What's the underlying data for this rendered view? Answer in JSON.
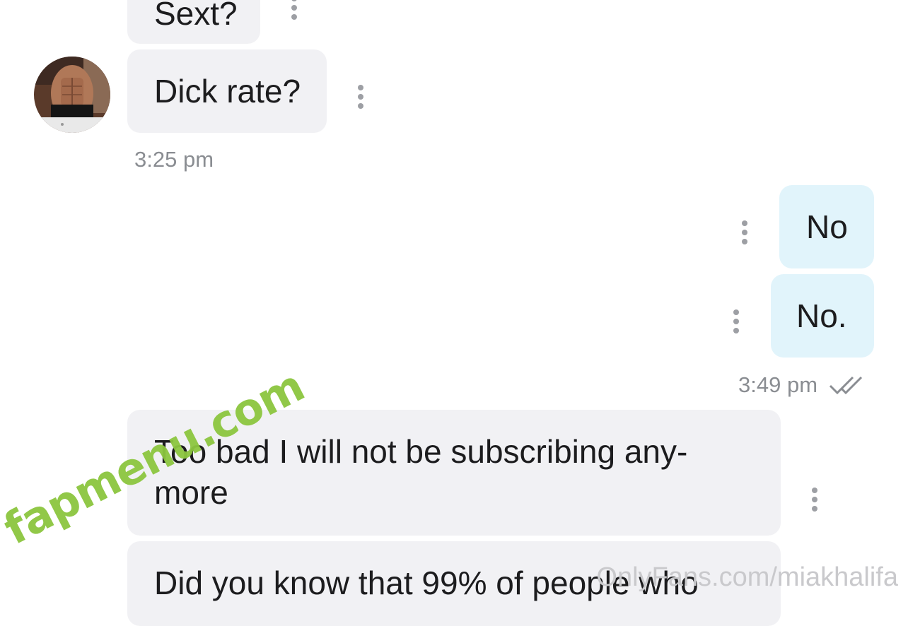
{
  "conversation": {
    "messages": [
      {
        "id": "m0",
        "direction": "incoming",
        "text": "Sext?"
      },
      {
        "id": "m1",
        "direction": "incoming",
        "text": "Dick rate?"
      },
      {
        "id": "m2",
        "direction": "outgoing",
        "text": "No"
      },
      {
        "id": "m3",
        "direction": "outgoing",
        "text": "No."
      },
      {
        "id": "m4",
        "direction": "incoming",
        "line1": "Too bad I will not be subscribing any-",
        "line2": "more"
      },
      {
        "id": "m5",
        "direction": "incoming",
        "text": "Did you know that 99% of people who"
      }
    ],
    "timestamps": {
      "incoming_1": "3:25 pm",
      "outgoing_1": "3:49 pm"
    },
    "read_receipt_icon": "double-check-icon",
    "more_icon": "vertical-dots-icon"
  },
  "watermarks": {
    "site": "fapmenu.com",
    "profile": "OnlyFans.com/miakhalifa"
  },
  "colors": {
    "incoming_bubble": "#f1f1f4",
    "outgoing_bubble": "#e1f4fb",
    "timestamp": "#8a8d92",
    "watermark_green": "#8cc63f"
  }
}
